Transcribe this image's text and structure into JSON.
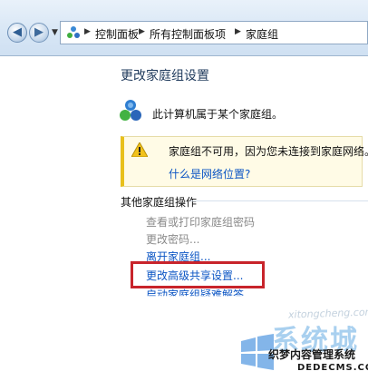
{
  "address": {
    "crumbs": [
      "控制面板",
      "所有控制面板项",
      "家庭组"
    ]
  },
  "page": {
    "title": "更改家庭组设置",
    "status_text": "此计算机属于某个家庭组。"
  },
  "warning": {
    "message": "家庭组不可用，因为您未连接到家庭网络。",
    "link": "什么是网络位置?"
  },
  "other_actions": {
    "label": "其他家庭组操作",
    "items": [
      {
        "label": "查看或打印家庭组密码",
        "state": "disabled"
      },
      {
        "label": "更改密码...",
        "state": "disabled"
      },
      {
        "label": "离开家庭组...",
        "state": "link"
      },
      {
        "label": "更改高级共享设置...",
        "state": "link"
      },
      {
        "label": "启动家庭组疑难解答",
        "state": "link"
      }
    ]
  },
  "watermark": {
    "brand": "系统城",
    "site_name": "织梦内容管理系统",
    "url": "DEDECMS.COM",
    "faint": "xitongcheng.com"
  },
  "colors": {
    "link": "#0b55c4",
    "highlight": "#c8242b",
    "warning": "#e8c01c"
  }
}
